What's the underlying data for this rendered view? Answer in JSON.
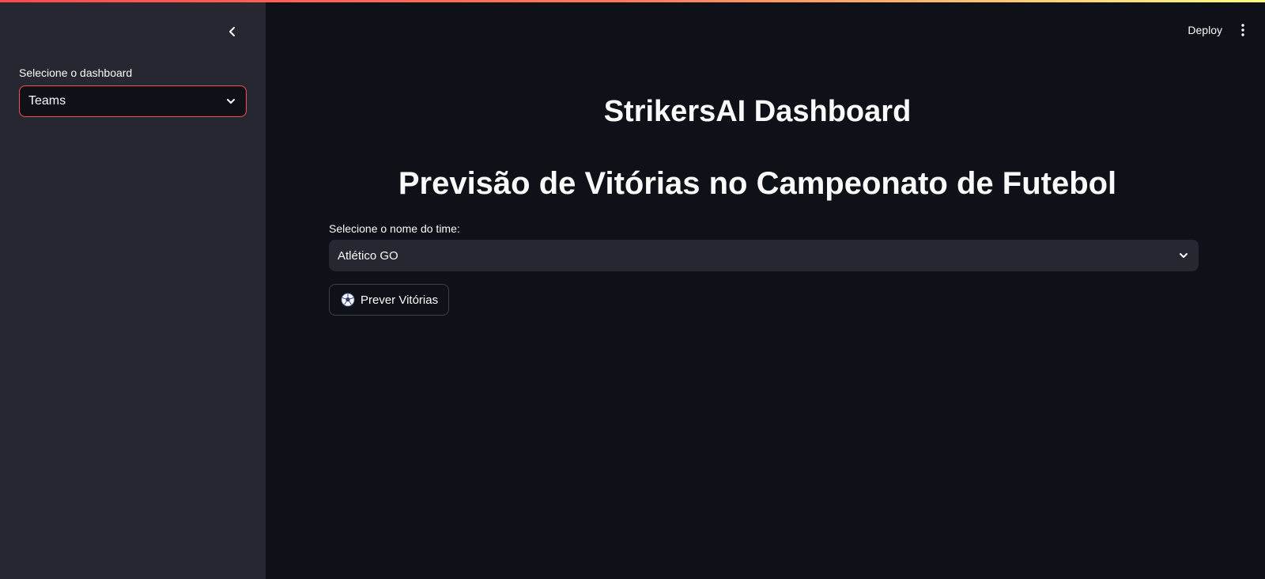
{
  "header": {
    "deploy_label": "Deploy",
    "menu_icon": "kebab-menu-icon"
  },
  "sidebar": {
    "collapse_icon": "chevron-left-icon",
    "select_label": "Selecione o dashboard",
    "select_value": "Teams",
    "select_icon": "chevron-down-icon"
  },
  "main": {
    "title": "StrikersAI Dashboard",
    "subtitle": "Previsão de Vitórias no Campeonato de Futebol",
    "team_select_label": "Selecione o nome do time:",
    "team_select_value": "Atlético GO",
    "predict_button_icon": "soccer-ball-icon",
    "predict_button_label": "Prever Vitórias"
  },
  "colors": {
    "background": "#0e1117",
    "sidebar": "#262730",
    "accent": "#ff4b4b",
    "text": "#fafafa"
  }
}
